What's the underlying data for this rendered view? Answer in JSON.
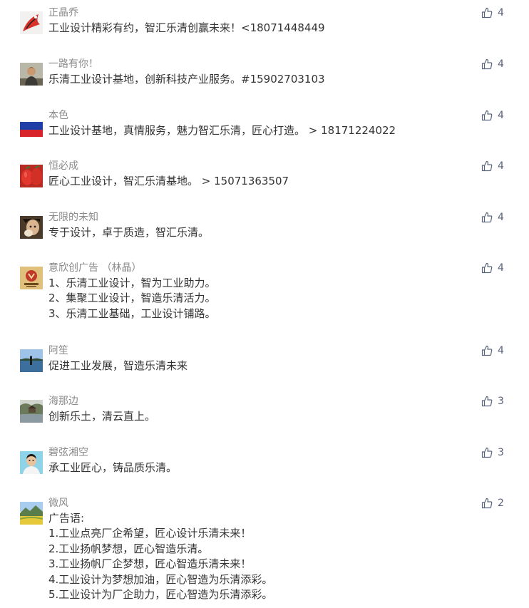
{
  "colors": {
    "name": "#8a8a8a",
    "text": "#333333",
    "like": "#59637a"
  },
  "like_icon": "thumbs-up-icon",
  "comments": [
    {
      "name": "正晶乔",
      "avatar": "red-dolphin-logo-avatar",
      "likes": "4",
      "lines": [
        "工业设计精彩有约，智汇乐清创赢未来！<18071448449"
      ]
    },
    {
      "name": "一路有你！",
      "avatar": "man-portrait-avatar",
      "likes": "4",
      "lines": [
        "乐清工业设计基地，创新科技产业服务。#15902703103"
      ]
    },
    {
      "name": "本色",
      "avatar": "russian-flag-avatar",
      "likes": "4",
      "lines": [
        "工业设计基地，真情服务，魅力智汇乐清，匠心打造。 > 18171224022"
      ]
    },
    {
      "name": "恒必成",
      "avatar": "red-peppers-avatar",
      "likes": "4",
      "lines": [
        "匠心工业设计，智汇乐清基地。 > 15071363507"
      ]
    },
    {
      "name": "无限的未知",
      "avatar": "person-closeup-avatar",
      "likes": "4",
      "lines": [
        "专于设计，卓于质造，智汇乐清。"
      ]
    },
    {
      "name": "意欣创广告 （林晶）",
      "avatar": "company-logo-avatar",
      "likes": "4",
      "lines": [
        "1、乐清工业设计，智为工业助力。",
        "2、集聚工业设计，智造乐清活力。",
        "3、乐清工业基础，工业设计铺路。"
      ]
    },
    {
      "name": "阿笙",
      "avatar": "lake-scenery-avatar",
      "likes": "4",
      "lines": [
        "促进工业发展，智造乐清未来"
      ]
    },
    {
      "name": "海那边",
      "avatar": "garden-scenery-avatar",
      "likes": "3",
      "lines": [
        "创新乐土，清云直上。"
      ]
    },
    {
      "name": "碧弦湘空",
      "avatar": "young-man-avatar",
      "likes": "3",
      "lines": [
        "承工业匠心，铸品质乐清。"
      ]
    },
    {
      "name": "微风",
      "avatar": "mountain-landscape-avatar",
      "likes": "2",
      "lines": [
        "广告语:",
        "1.工业点亮厂企希望，匠心设计乐清未来！",
        "2.工业扬帆梦想，匠心智造乐清。",
        "3.工业扬帆厂企梦想，匠心智造乐清未来！",
        "4.工业设计为梦想加油，匠心智造为乐清添彩。",
        "5.工业设计为厂企助力，匠心智造为乐清添彩。"
      ]
    }
  ]
}
